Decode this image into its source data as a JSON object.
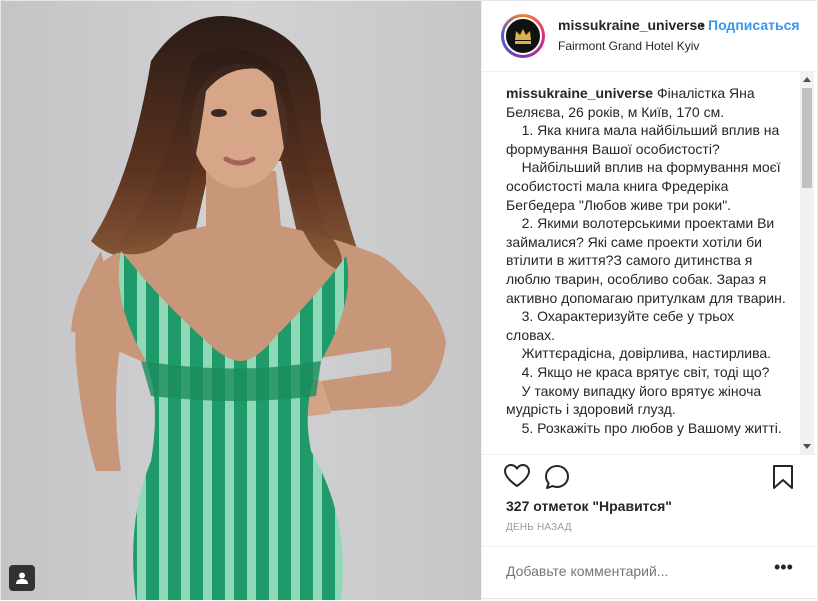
{
  "header": {
    "username": "missukraine_universe",
    "separator": "•",
    "follow_label": "Подписаться",
    "location": "Fairmont Grand Hotel Kyiv"
  },
  "caption": {
    "username": "missukraine_universe",
    "text": " Фіналістка Яна Беляєва, 26 років, м Київ, 170 см.\n    1. Яка книга мала найбільший вплив на формування Вашої особистості?\n    Найбільший вплив на формування моєї особистості мала книга Фредеріка Бегбедера \"Любов живе три роки\".\n    2. Якими волотерськими проектами Ви займалися? Які саме проекти хотіли би втілити в життя?З самого дитинства я люблю тварин, особливо собак. Зараз я активно допомагаю притулкам для тварин.\n    3. Охарактеризуйте себе у трьох словах.\n    Життєрадісна, довірлива, настирлива.\n    4. Якщо не краса врятує світ, тоді що?\n    У такому випадку його врятує жіноча мудрість і здоровий глузд.\n    5. Розкажіть про любов у Вашому житті."
  },
  "likes": "327 отметок \"Нравится\"",
  "time": "ДЕНЬ НАЗАД",
  "comment": {
    "placeholder": "Добавьте комментарий...",
    "more": "•••"
  },
  "icons": {
    "like": "heart-icon",
    "comment": "comment-icon",
    "save": "bookmark-icon",
    "tag": "user-tag-icon",
    "avatar": "crown-logo"
  },
  "colors": {
    "follow": "#3897f0",
    "dress": "#2aa874",
    "background": "#c9c9cb"
  }
}
